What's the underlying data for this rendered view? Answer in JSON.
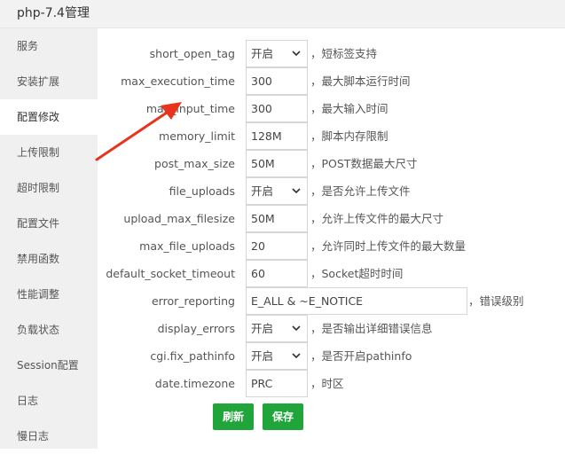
{
  "window": {
    "title": "php-7.4管理"
  },
  "sidebar": {
    "items": [
      {
        "label": "服务"
      },
      {
        "label": "安装扩展"
      },
      {
        "label": "配置修改"
      },
      {
        "label": "上传限制"
      },
      {
        "label": "超时限制"
      },
      {
        "label": "配置文件"
      },
      {
        "label": "禁用函数"
      },
      {
        "label": "性能调整"
      },
      {
        "label": "负载状态"
      },
      {
        "label": "Session配置"
      },
      {
        "label": "日志"
      },
      {
        "label": "慢日志"
      }
    ],
    "active_index": 2
  },
  "settings": [
    {
      "name": "short_open_tag",
      "type": "select",
      "value": "开启",
      "desc": "，短标签支持"
    },
    {
      "name": "max_execution_time",
      "type": "input",
      "value": "300",
      "desc": "，最大脚本运行时间"
    },
    {
      "name": "max_input_time",
      "type": "input",
      "value": "300",
      "desc": "，最大输入时间"
    },
    {
      "name": "memory_limit",
      "type": "input",
      "value": "128M",
      "desc": "，脚本内存限制"
    },
    {
      "name": "post_max_size",
      "type": "input",
      "value": "50M",
      "desc": "，POST数据最大尺寸"
    },
    {
      "name": "file_uploads",
      "type": "select",
      "value": "开启",
      "desc": "，是否允许上传文件"
    },
    {
      "name": "upload_max_filesize",
      "type": "input",
      "value": "50M",
      "desc": "，允许上传文件的最大尺寸"
    },
    {
      "name": "max_file_uploads",
      "type": "input",
      "value": "20",
      "desc": "，允许同时上传文件的最大数量"
    },
    {
      "name": "default_socket_timeout",
      "type": "input",
      "value": "60",
      "desc": "，Socket超时时间"
    },
    {
      "name": "error_reporting",
      "type": "input-wide",
      "value": "E_ALL & ~E_NOTICE",
      "desc": "，错误级别"
    },
    {
      "name": "display_errors",
      "type": "select",
      "value": "开启",
      "desc": "，是否输出详细错误信息"
    },
    {
      "name": "cgi.fix_pathinfo",
      "type": "select",
      "value": "开启",
      "desc": "，是否开启pathinfo"
    },
    {
      "name": "date.timezone",
      "type": "input",
      "value": "PRC",
      "desc": "，时区"
    }
  ],
  "buttons": {
    "refresh": "刷新",
    "save": "保存"
  },
  "colors": {
    "accent": "#20a53a",
    "annotation_arrow": "#e8341c"
  }
}
